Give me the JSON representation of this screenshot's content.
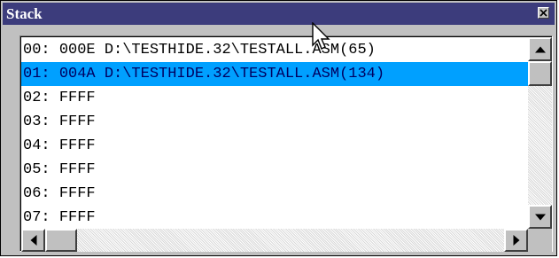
{
  "window": {
    "title": "Stack",
    "close_glyph": "✕"
  },
  "stack_list": {
    "rows": [
      {
        "index": "00:",
        "value": "000E D:\\TESTHIDE.32\\TESTALL.ASM(65)",
        "selected": false
      },
      {
        "index": "01:",
        "value": "004A D:\\TESTHIDE.32\\TESTALL.ASM(134)",
        "selected": true
      },
      {
        "index": "02:",
        "value": "FFFF",
        "selected": false
      },
      {
        "index": "03:",
        "value": "FFFF",
        "selected": false
      },
      {
        "index": "04:",
        "value": "FFFF",
        "selected": false
      },
      {
        "index": "05:",
        "value": "FFFF",
        "selected": false
      },
      {
        "index": "06:",
        "value": "FFFF",
        "selected": false
      },
      {
        "index": "07:",
        "value": "FFFF",
        "selected": false
      }
    ]
  },
  "scrollbars": {
    "vertical": {
      "up_icon": "arrow-up-icon",
      "down_icon": "arrow-down-icon"
    },
    "horizontal": {
      "left_icon": "arrow-left-icon",
      "right_icon": "arrow-right-icon"
    }
  },
  "colors": {
    "titlebar": "#3c3c7c",
    "selection": "#00a0ff",
    "face": "#c0c0c0"
  }
}
